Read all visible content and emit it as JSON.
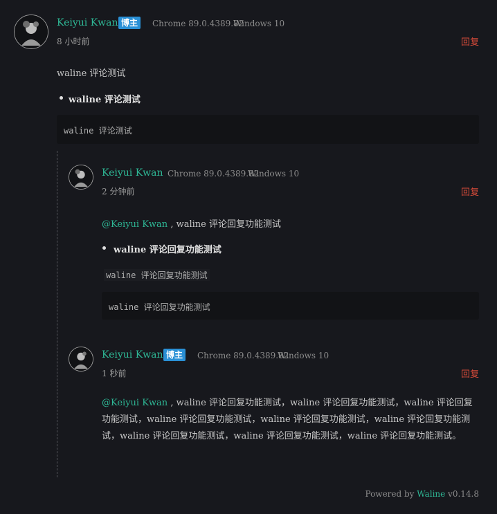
{
  "comments": [
    {
      "nick": "Keiyui Kwan",
      "badge": "博主",
      "browser": "Chrome 89.0.4389.82",
      "os": "Windows 10",
      "time": "8 小时前",
      "reply": "回复",
      "paragraph": "waline 评论测试",
      "list_item": "waline 评论测试",
      "code": "waline 评论测试"
    }
  ],
  "replies": [
    {
      "nick": "Keiyui Kwan",
      "browser": "Chrome 89.0.4389.82",
      "os": "Windows 10",
      "time": "2 分钟前",
      "reply": "回复",
      "mention": "@Keiyui Kwan",
      "paragraph_rest": " , waline 评论回复功能测试",
      "list_item": "waline 评论回复功能测试",
      "inline_code": "waline 评论回复功能测试",
      "code": "waline 评论回复功能测试"
    },
    {
      "nick": "Keiyui Kwan",
      "badge": "博主",
      "browser": "Chrome 89.0.4389.82",
      "os": "Windows 10",
      "time": "1 秒前",
      "reply": "回复",
      "mention": "@Keiyui Kwan",
      "paragraph_rest": " , waline 评论回复功能测试，waline 评论回复功能测试，waline 评论回复功能测试，waline 评论回复功能测试，waline 评论回复功能测试，waline 评论回复功能测试，waline 评论回复功能测试，waline 评论回复功能测试，waline 评论回复功能测试。"
    }
  ],
  "footer": {
    "prefix": "Powered by ",
    "link": "Waline",
    "version": " v0.14.8"
  },
  "colors": {
    "background": "#17181d",
    "nick": "#2eb795",
    "badge": "#2a90d6",
    "reply": "#d94b3a"
  }
}
